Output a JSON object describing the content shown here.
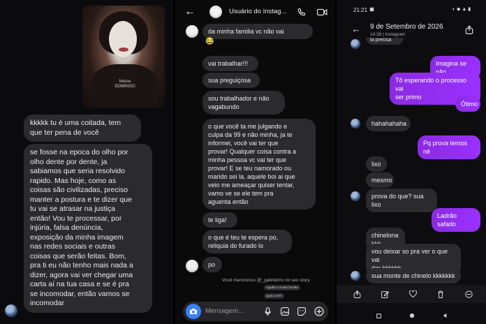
{
  "panel1": {
    "photo_caption": "Nesse\nDOMINGO",
    "messages": [
      "kkkkk tu é uma coitada, tem\nque ter pena de você",
      "se fosse na epoca do olho por\nolho dente por dente, ja\nsabiamos que seria resolvido\nrapido. Mas hoje, como as\ncoisas são civilizadas, preciso\nmanter a postura e te dizer que\ntu vai se atrasar na justiça\nentão! Vou te processar, por\ninjúria, falsa denúncia,\nexposição da minha imagem\nnas redes sociais e outras\ncoisas que serão feitas. Bom,\npra ti eu não tenho mais nada a\ndizer, agora vai ver chegar uma\ncarta aí na tua casa e se é pra\nse incomodar, então vamos se\nincomodar"
    ]
  },
  "panel2": {
    "title": "Usuário do Instag...",
    "messages": [
      "da minha familia vc não vai",
      "😂",
      "vai trabalhar!!!",
      "sua preguiçosa",
      "sou trabalhador e não\nvagabundo",
      "o que você ta me julgando e\nculpa da 99 e não minha, ja te\ninformei, você vai ter que\nprovar! Qualquer coisa contra a\nminha pessoa vc vai ter que\nprovar! E se teu namorado ou\nmarido sei la, aquele boi ai que\nveio me ameaçar quiser tentar,\nvamo ve se ele tem pra\naguenta então",
      "te liga!",
      "o que é teu te espera po,\nreliquia do furado lo",
      "po"
    ],
    "story_mention": "Você mencionou @_gabrielmv no seu story",
    "reactions": [
      "orgulho a muito homão",
      "igual a mim"
    ],
    "composer_placeholder": "Mensagem..."
  },
  "panel3": {
    "status_time": "21:21",
    "title": "9 de Setembro de 2026",
    "subtitle": "14:38 | Instagram",
    "top_fragment": "ta precisa",
    "messages_me": [
      "Imagina se não",
      "Tô esperando o processo vai\nser primo",
      "Ótimo",
      "Pq prova temos né",
      "Ladrão safado"
    ],
    "messages_them": [
      "hahahahaha",
      "lixo",
      "mesmo",
      "prova do que? sua lixo",
      "chinelona kkk",
      "vou deixar so pra ver o que vai\ndar kkkkkk",
      "sua monte de chinelo kkkkkkk"
    ]
  },
  "colors": {
    "accent": "#8a2be2",
    "bubble": "#2b2b2e",
    "camera": "#3a82f7"
  }
}
